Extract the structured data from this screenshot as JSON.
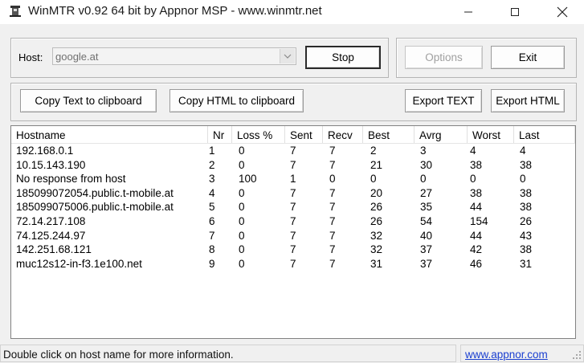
{
  "window": {
    "title": "WinMTR v0.92 64 bit by Appnor MSP - www.winmtr.net"
  },
  "host": {
    "label": "Host:",
    "value": "google.at"
  },
  "buttons": {
    "stop": "Stop",
    "options": "Options",
    "exit": "Exit",
    "copy_text": "Copy Text to clipboard",
    "copy_html": "Copy HTML to clipboard",
    "export_text": "Export TEXT",
    "export_html": "Export HTML"
  },
  "table": {
    "columns": [
      "Hostname",
      "Nr",
      "Loss %",
      "Sent",
      "Recv",
      "Best",
      "Avrg",
      "Worst",
      "Last"
    ],
    "rows": [
      [
        "192.168.0.1",
        "1",
        "0",
        "7",
        "7",
        "2",
        "3",
        "4",
        "4"
      ],
      [
        "10.15.143.190",
        "2",
        "0",
        "7",
        "7",
        "21",
        "30",
        "38",
        "38"
      ],
      [
        "No response from host",
        "3",
        "100",
        "1",
        "0",
        "0",
        "0",
        "0",
        "0"
      ],
      [
        "185099072054.public.t-mobile.at",
        "4",
        "0",
        "7",
        "7",
        "20",
        "27",
        "38",
        "38"
      ],
      [
        "185099075006.public.t-mobile.at",
        "5",
        "0",
        "7",
        "7",
        "26",
        "35",
        "44",
        "38"
      ],
      [
        "72.14.217.108",
        "6",
        "0",
        "7",
        "7",
        "26",
        "54",
        "154",
        "26"
      ],
      [
        "74.125.244.97",
        "7",
        "0",
        "7",
        "7",
        "32",
        "40",
        "44",
        "43"
      ],
      [
        "142.251.68.121",
        "8",
        "0",
        "7",
        "7",
        "32",
        "37",
        "42",
        "38"
      ],
      [
        "muc12s12-in-f3.1e100.net",
        "9",
        "0",
        "7",
        "7",
        "31",
        "37",
        "46",
        "31"
      ]
    ]
  },
  "status": {
    "message": "Double click on host name for more information.",
    "link": "www.appnor.com"
  },
  "icons": {
    "app": "winmtr-app-icon",
    "minimize": "minimize-icon",
    "maximize": "maximize-icon",
    "close": "close-icon",
    "dropdown": "chevron-down-icon",
    "grip": "resize-grip-icon"
  }
}
